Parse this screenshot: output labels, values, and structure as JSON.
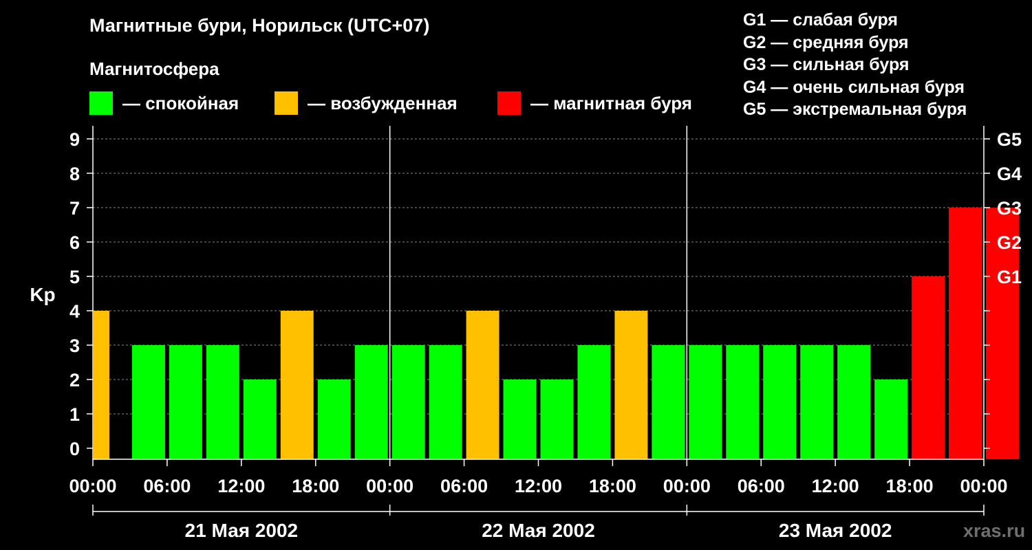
{
  "header": {
    "title": "Магнитные бури, Норильск (UTC+07)",
    "subtitle": "Магнитосфера"
  },
  "legend": {
    "items": [
      {
        "label": "— спокойная",
        "color": "#00ff00"
      },
      {
        "label": "— возбужденная",
        "color": "#ffc000"
      },
      {
        "label": "— магнитная буря",
        "color": "#ff0000"
      }
    ]
  },
  "storm_legend": [
    "G1 — слабая буря",
    "G2 — средняя буря",
    "G3 — сильная буря",
    "G4 — очень сильная буря",
    "G5 — экстремальная буря"
  ],
  "watermark": "xras.ru",
  "chart_data": {
    "type": "bar",
    "ylabel": "Kp",
    "ylim": [
      0,
      9
    ],
    "yticks": [
      "0",
      "1",
      "2",
      "3",
      "4",
      "5",
      "6",
      "7",
      "8",
      "9"
    ],
    "right_ticks": [
      {
        "value": 5,
        "label": "G1"
      },
      {
        "value": 6,
        "label": "G2"
      },
      {
        "value": 7,
        "label": "G3"
      },
      {
        "value": 8,
        "label": "G4"
      },
      {
        "value": 9,
        "label": "G5"
      }
    ],
    "x_tick_labels": [
      "00:00",
      "06:00",
      "12:00",
      "18:00",
      "00:00",
      "06:00",
      "12:00",
      "18:00",
      "00:00",
      "06:00",
      "12:00",
      "18:00",
      "00:00"
    ],
    "x_tick_interval_hours": 6,
    "bar_interval_hours": 3,
    "days": [
      "21 Мая 2002",
      "22 Мая 2002",
      "23 Мая 2002"
    ],
    "grid": true,
    "values": [
      4,
      3,
      3,
      3,
      2,
      4,
      2,
      3,
      3,
      3,
      4,
      2,
      2,
      3,
      4,
      3,
      3,
      3,
      3,
      3,
      3,
      2,
      5,
      7,
      7
    ],
    "colors": {
      "calm": "#00ff00",
      "active": "#ffc000",
      "storm": "#ff0000"
    }
  }
}
